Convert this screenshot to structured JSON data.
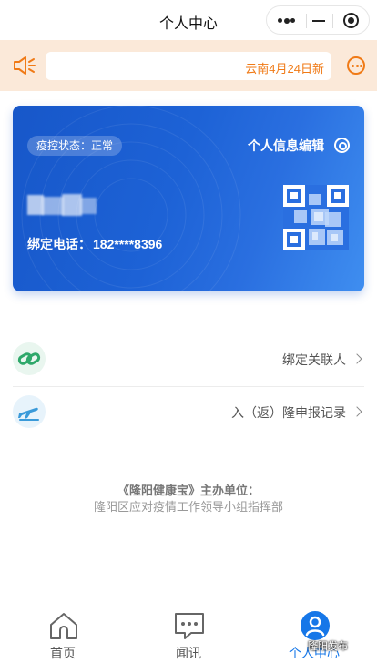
{
  "titlebar": {
    "title": "个人中心"
  },
  "notice": {
    "text": "云南4月24日新"
  },
  "card": {
    "status_label": "疫控状态：正常",
    "edit_label": "个人信息编辑",
    "phone_label": "绑定电话：",
    "phone_value": "182****8396"
  },
  "list": {
    "items": [
      {
        "label": "绑定关联人",
        "icon": "link-icon"
      },
      {
        "label": "入（返）隆申报记录",
        "icon": "plane-icon"
      }
    ]
  },
  "sponsor": {
    "title": "《隆阳健康宝》主办单位：",
    "org": "隆阳区应对疫情工作领导小组指挥部"
  },
  "tabbar": {
    "tabs": [
      {
        "label": "首页",
        "icon": "home-icon",
        "active": false
      },
      {
        "label": "闻讯",
        "icon": "message-icon",
        "active": false
      },
      {
        "label": "个人中心",
        "icon": "user-icon",
        "active": true
      }
    ]
  },
  "watermark": "隆阳发布",
  "colors": {
    "accent": "#1677e8",
    "notice_bg": "#fbe9d9",
    "notice_text": "#f07a16",
    "card_blue": "#1d62d6",
    "link_green": "#2ea86a",
    "plane_blue": "#3a9ad9"
  }
}
